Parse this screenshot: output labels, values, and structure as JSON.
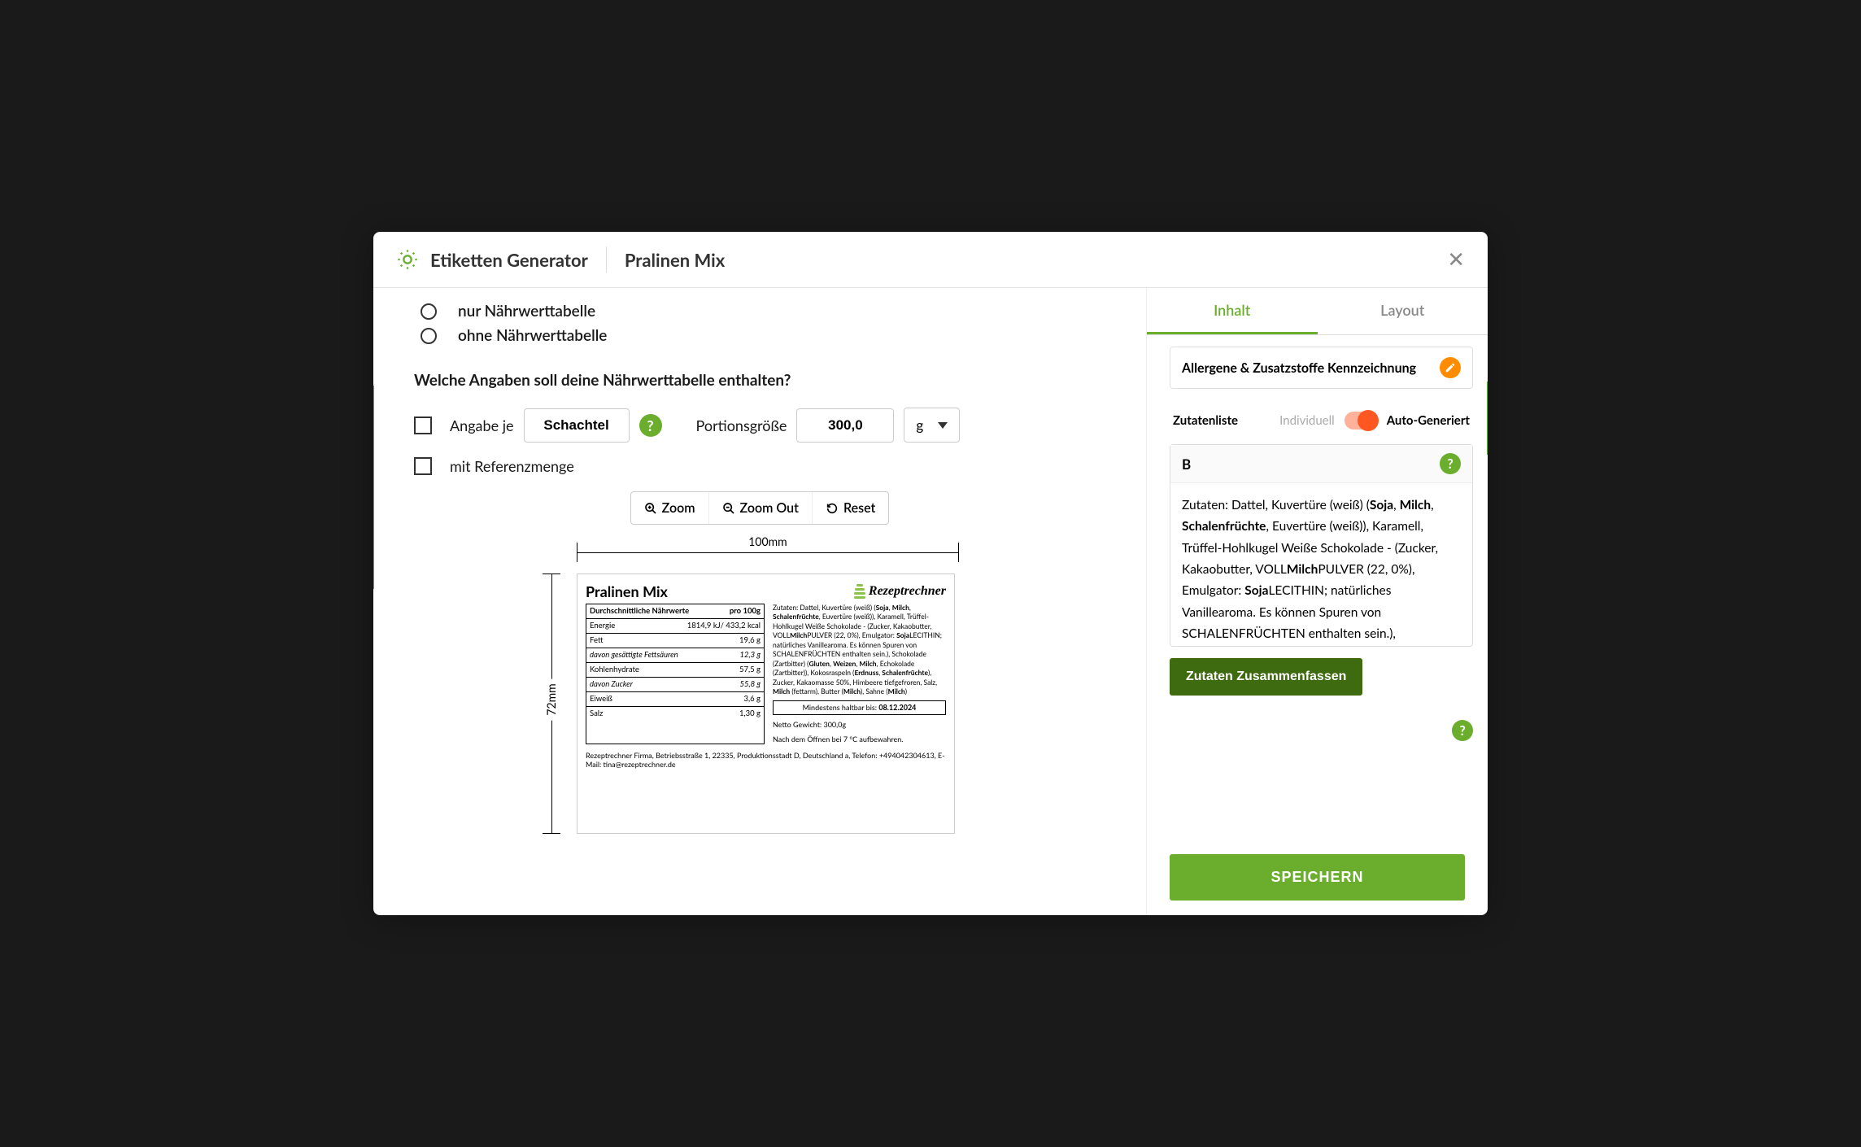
{
  "header": {
    "app": "Etiketten Generator",
    "title": "Pralinen Mix"
  },
  "left": {
    "radio1": "nur Nährwerttabelle",
    "radio2": "ohne Nährwerttabelle",
    "question": "Welche Angaben soll deine Nährwerttabelle enthalten?",
    "angabe_je": "Angabe je",
    "schachtel": "Schachtel",
    "portion_label": "Portionsgröße",
    "portion_val": "300,0",
    "unit": "g",
    "ref": "mit Referenzmenge",
    "zoom": "Zoom",
    "zoom_out": "Zoom Out",
    "reset": "Reset",
    "width": "100mm",
    "height": "72mm"
  },
  "label": {
    "title": "Pralinen Mix",
    "brand": "Rezeptrechner",
    "nutr_header": "Durchschnittliche Nährwerte",
    "per": "pro 100g",
    "rows": [
      {
        "k": "Energie",
        "v": "1814,9 kJ/ 433,2 kcal"
      },
      {
        "k": "Fett",
        "v": "19,6 g"
      },
      {
        "k": "davon gesättigte Fettsäuren",
        "v": "12,3 g",
        "sub": true
      },
      {
        "k": "Kohlenhydrate",
        "v": "57,5 g"
      },
      {
        "k": "davon Zucker",
        "v": "55,8 g",
        "sub": true
      },
      {
        "k": "Eiweiß",
        "v": "3,6 g"
      },
      {
        "k": "Salz",
        "v": "1,30 g"
      }
    ],
    "ingredients_html": "Zutaten: Dattel, Kuvertüre (weiß) (<b>Soja</b>, <b>Milch</b>, <b>Schalenfrüchte</b>, Euvertüre (weiß)), Karamell, Trüffel-Hohlkugel Weiße Schokolade - (Zucker, Kakaobutter, VOLL<b>Milch</b>PULVER (22, 0%), Emulgator: <b>Soja</b>LECITHIN; natürliches Vanillearoma. Es können Spuren von SCHALENFRÜCHTEN enthalten sein.), Schokolade (Zartbitter) (<b>Gluten</b>, <b>Weizen</b>, <b>Milch</b>, Echokolade (Zartbitter)), Kokosraspeln (<b>Erdnuss</b>, <b>Schalenfrüchte</b>), Zucker, Kakaomasse 50%, Himbeere tiefgefroren, Salz, <b>Milch</b> (fettarm), Butter (<b>Milch</b>), Sahne (<b>Milch</b>)",
    "bbf_label": "Mindestens haltbar bis:",
    "bbf_date": "08.12.2024",
    "net": "Netto Gewicht: 300,0g",
    "storage": "Nach dem Öffnen bei 7 °C aufbewahren.",
    "company": "Rezeptrechner Firma, Betriebsstraße 1, 22335, Produktionsstadt D, Deutschland a, Telefon: +494042304613, E-Mail: tina@rezeptrechner.de"
  },
  "right": {
    "tab_inhalt": "Inhalt",
    "tab_layout": "Layout",
    "allergene": "Allergene & Zusatzstoffe Kennzeichnung",
    "zutatenliste": "Zutatenliste",
    "individuell": "Individuell",
    "auto": "Auto-Generiert",
    "b": "B",
    "ing_html": "Zutaten: Dattel, Kuvertüre (weiß) (<b>Soja</b>, <b>Milch</b>, <b>Schalenfrüchte</b>, Euvertüre (weiß)), Karamell, Trüffel-Hohlkugel Weiße Schokolade - (Zucker, Kakaobutter, VOLL<b>Milch</b>PULVER (22, 0%), Emulgator: <b>Soja</b>LECITHIN; natürliches Vanillearoma. Es können Spuren von SCHALENFRÜCHTEN enthalten sein.), Schokolade (Zartbitter) (<b>Gluten</b>, <b>Weizen</b>,",
    "summarize": "Zutaten Zusammenfassen",
    "save": "SPEICHERN"
  }
}
